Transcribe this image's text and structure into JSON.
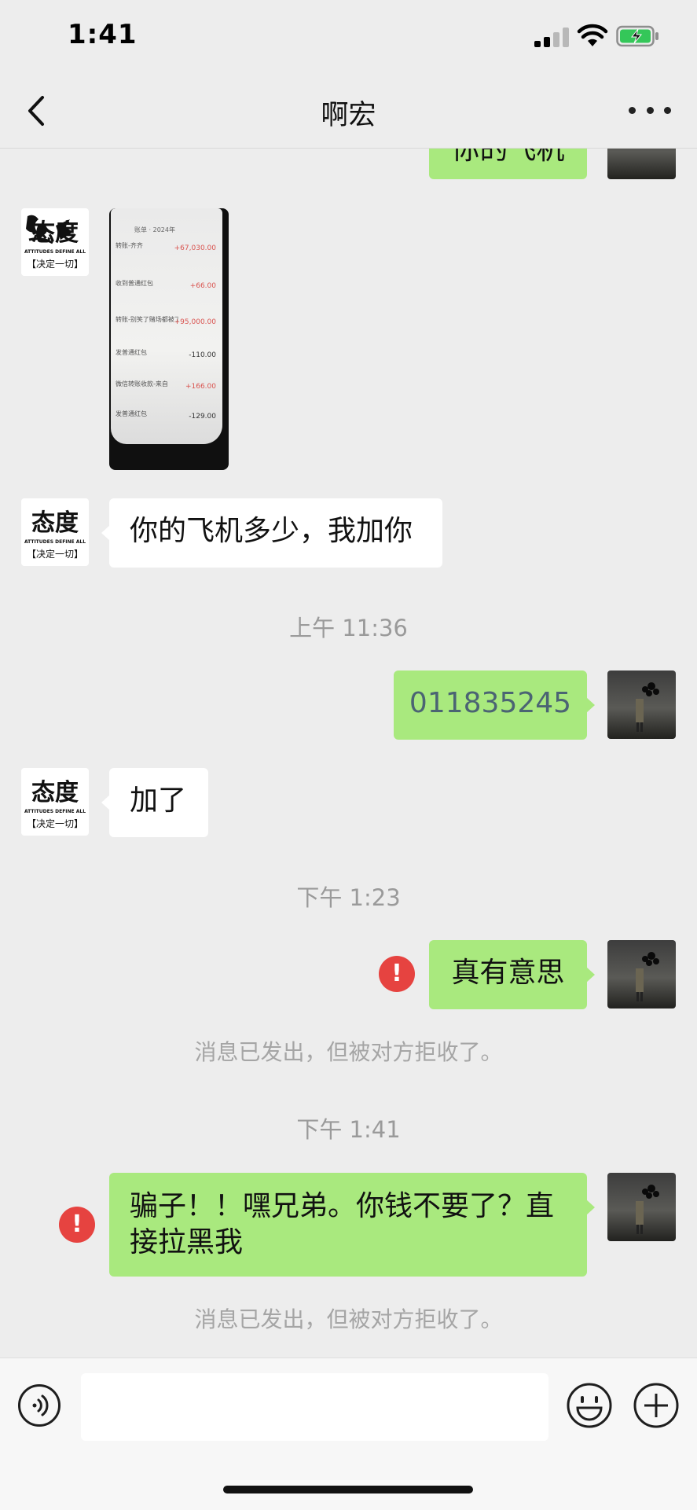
{
  "status_bar": {
    "time": "1:41"
  },
  "nav": {
    "title": "啊宏"
  },
  "contact_avatar": {
    "logo_text": "态度",
    "tagline_en": "ATTITUDES DEFINE ALL",
    "tagline_cn": "【决定一切】"
  },
  "messages": {
    "top_partial": "你的飞机",
    "photo": {
      "header": "账单 · 2024年",
      "rows": [
        {
          "label": "转账-齐齐",
          "amount": "+67,030.00"
        },
        {
          "label": "收到普通红包",
          "amount": "+66.00"
        },
        {
          "label": "转账-别笑了赌场都被了",
          "amount": "+95,000.00"
        },
        {
          "label": "发普通红包",
          "amount": "-110.00"
        },
        {
          "label": "微信转账收款-来自",
          "amount": "+166.00"
        },
        {
          "label": "发普通红包",
          "amount": "-129.00"
        }
      ]
    },
    "ask_plane": "你的飞机多少，我加你",
    "time1": "上午 11:36",
    "number_reply": "011835245",
    "added": "加了",
    "time2": "下午 1:23",
    "interesting": "真有意思",
    "rejected_1": "消息已发出，但被对方拒收了。",
    "time3": "下午 1:41",
    "scammer": "骗子！！嘿兄弟。你钱不要了？直接拉黑我",
    "rejected_2": "消息已发出，但被对方拒收了。"
  },
  "error_icon": {
    "glyph": "!"
  },
  "input_bar": {
    "value": "",
    "placeholder": ""
  },
  "colors": {
    "background": "#ededed",
    "bubble_sent": "#a9e97e",
    "bubble_received": "#ffffff",
    "error": "#e64340",
    "timestamp_text": "#9a9a9a",
    "battery_charging": "#34c759"
  },
  "icons": {
    "back": "chevron-left-icon",
    "more": "ellipsis-icon",
    "voice": "voice-icon",
    "emoji": "smiley-icon",
    "plus": "plus-icon",
    "error": "exclamation-icon"
  }
}
